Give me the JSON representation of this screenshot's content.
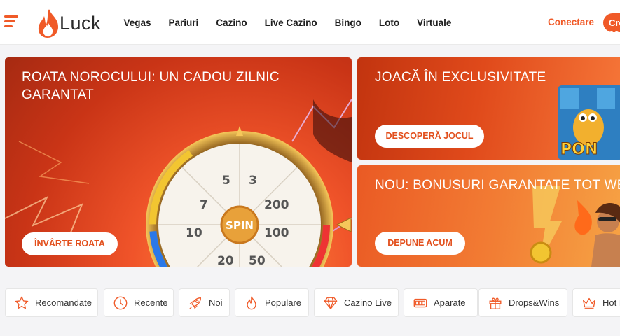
{
  "header": {
    "logo_text": "Luck",
    "nav": [
      "Vegas",
      "Pariuri",
      "Cazino",
      "Live Cazino",
      "Bingo",
      "Loto",
      "Virtuale"
    ],
    "login_label": "Conectare",
    "register_label": "Creează cont"
  },
  "banners": [
    {
      "title_line1": "ROATA NOROCULUI: UN CADOU ZILNIC",
      "title_line2": "GARANTAT",
      "button": "ÎNVÂRTE ROATA",
      "wheel_center": "SPIN",
      "wheel_labels": [
        "5",
        "3",
        "200",
        "100",
        "50",
        "20",
        "10",
        "7"
      ]
    },
    {
      "title": "JOACĂ ÎN EXCLUSIVITATE",
      "button": "DESCOPERĂ JOCUL",
      "art_text": "PON"
    },
    {
      "title": "NOU: BONUSURI GARANTATE TOT WEEKENDUL",
      "button": "DEPUNE ACUM"
    }
  ],
  "categories": [
    {
      "label": "Recomandate",
      "icon": "star-icon"
    },
    {
      "label": "Recente",
      "icon": "clock-icon"
    },
    {
      "label": "Noi",
      "icon": "rocket-icon"
    },
    {
      "label": "Populare",
      "icon": "flame-icon"
    },
    {
      "label": "Cazino Live",
      "icon": "diamond-icon"
    },
    {
      "label": "Aparate",
      "icon": "slot-machine-icon"
    },
    {
      "label": "Drops&Wins",
      "icon": "gift-icon"
    },
    {
      "label": "Hot Pick",
      "icon": "crown-icon"
    }
  ],
  "colors": {
    "accent": "#f05a28",
    "button_text": "#e24f1c"
  }
}
